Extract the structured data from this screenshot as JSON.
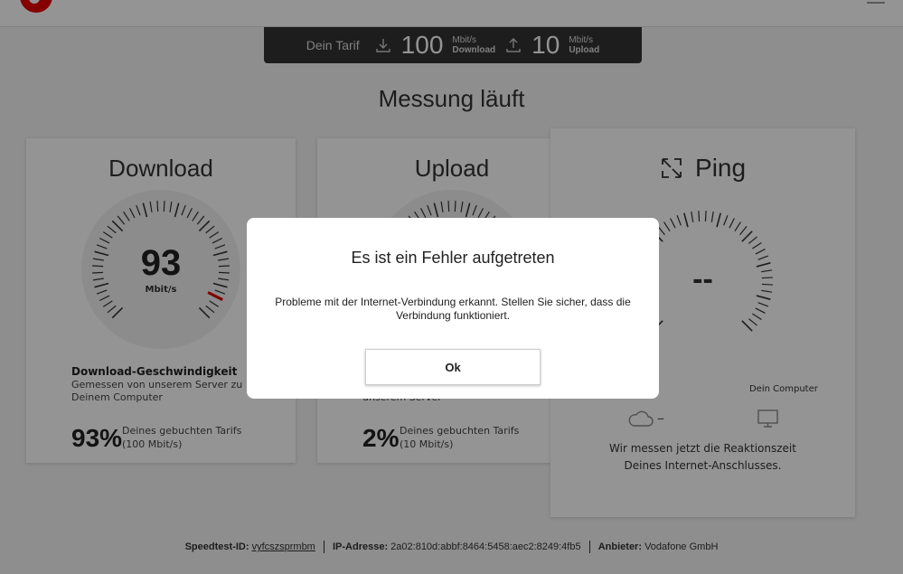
{
  "tarif": {
    "label": "Dein Tarif",
    "download_value": "100",
    "download_unit": "Mbit/s",
    "download_label": "Download",
    "upload_value": "10",
    "upload_unit": "Mbit/s",
    "upload_label": "Upload"
  },
  "headline": "Messung läuft",
  "download": {
    "title": "Download",
    "value": "93",
    "unit": "Mbit/s",
    "info_title": "Download-Geschwindigkeit",
    "info_text_1": "Gemessen von unserem Server zu",
    "info_text_2": "Deinem Computer",
    "percent": "93%",
    "percent_text_1": "Deines gebuchten Tarifs",
    "percent_text_2": "(100 Mbit/s)",
    "gauge_fraction": 0.93
  },
  "upload": {
    "title": "Upload",
    "info_text_2": "unserem Server",
    "percent": "2%",
    "percent_text_1": "Deines gebuchten Tarifs",
    "percent_text_2": "(10 Mbit/s)"
  },
  "ping": {
    "title": "Ping",
    "value": "--",
    "computer_label": "Dein Computer",
    "cloud_dash": "–",
    "text_1": "Wir messen jetzt die Reaktionszeit",
    "text_2": "Deines Internet-Anschlusses."
  },
  "modal": {
    "title": "Es ist ein Fehler aufgetreten",
    "message": "Probleme mit der Internet-Verbindung erkannt. Stellen Sie sicher, dass die Verbindung funktioniert.",
    "ok_label": "Ok"
  },
  "footer": {
    "speedtest_label": "Speedtest-ID:",
    "speedtest_value": "vyfcszsprmbm",
    "ip_label": "IP-Adresse:",
    "ip_value": "2a02:810d:abbf:8464:5458:aec2:8249:4fb5",
    "provider_label": "Anbieter:",
    "provider_value": "Vodafone GmbH"
  },
  "colors": {
    "brand": "#e60000",
    "dark_bar": "#333333"
  }
}
